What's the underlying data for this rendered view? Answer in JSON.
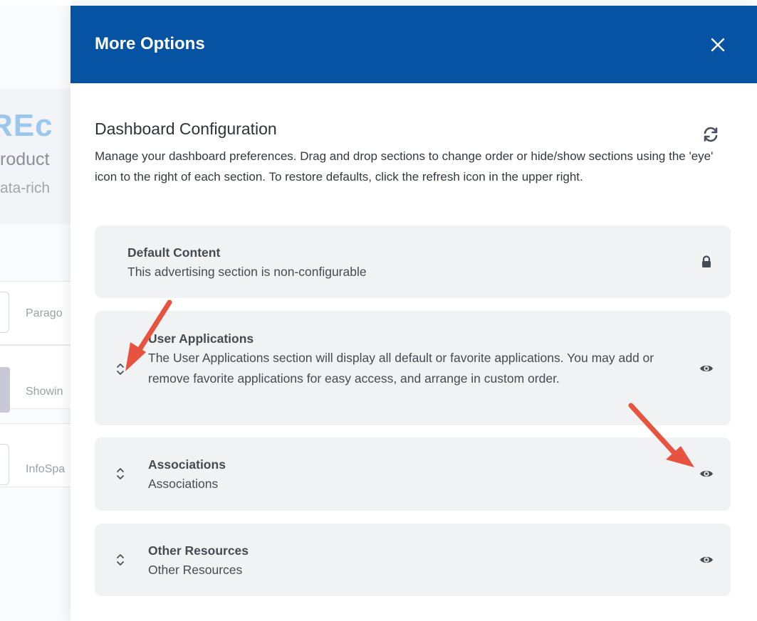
{
  "background": {
    "hero_title": "REc",
    "hero_line1": "roduct",
    "hero_line2": "ata-rich",
    "cards": [
      {
        "text": "Parago"
      },
      {
        "text": "Showin"
      },
      {
        "text": "InfoSpa"
      }
    ]
  },
  "panel": {
    "title": "More Options",
    "config": {
      "title": "Dashboard Configuration",
      "description": "Manage your dashboard preferences. Drag and drop sections to change order or hide/show sections using the 'eye' icon to the right of each section. To restore defaults, click the refresh icon in the upper right."
    },
    "items": [
      {
        "title": "Default Content",
        "description": "This advertising section is non-configurable",
        "icon": "lock-icon",
        "draggable": false
      },
      {
        "title": "User Applications",
        "description": "The User Applications section will display all default or favorite applications. You may add or remove favorite applications for easy access, and arrange in custom order.",
        "icon": "eye-icon",
        "draggable": true
      },
      {
        "title": "Associations",
        "description": "Associations",
        "icon": "eye-icon",
        "draggable": true
      },
      {
        "title": "Other Resources",
        "description": "Other Resources",
        "icon": "eye-icon",
        "draggable": true
      }
    ]
  },
  "colors": {
    "header": "#0753a3",
    "item_background": "#f1f2f4",
    "annotation_arrow": "#e8533f"
  }
}
